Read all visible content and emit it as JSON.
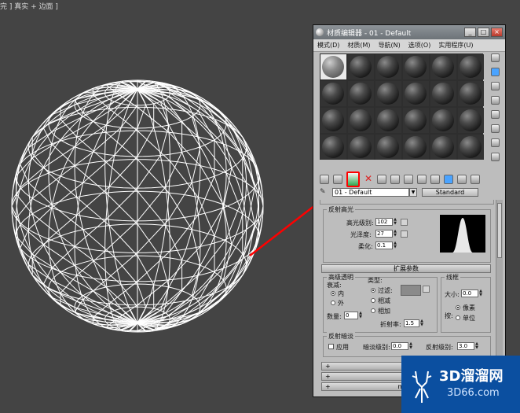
{
  "viewport": {
    "label": "完 ] 真实 + 边面 ]"
  },
  "material_editor": {
    "title": "材质编辑器 - 01 - Default",
    "window_buttons": [
      "_",
      "□",
      "×"
    ],
    "menus": [
      "模式(D)",
      "材质(M)",
      "导航(N)",
      "选项(O)",
      "实用程序(U)"
    ],
    "slot_count": 24,
    "material_name": "01 - Default",
    "material_type": "Standard",
    "specular_highlights": {
      "title": "反射高光",
      "specular_level_label": "高光级别:",
      "specular_level": "102",
      "glossiness_label": "光泽度:",
      "glossiness": "27",
      "soften_label": "柔化:",
      "soften": "0.1"
    },
    "extended_params": {
      "header": "扩展参数",
      "advanced_transparency_label": "高级透明",
      "falloff_label": "衰减:",
      "falloff_in": "内",
      "falloff_out": "外",
      "amount_label": "数量:",
      "amount": "0",
      "type_label": "类型:",
      "type_filter": "过滤:",
      "type_subtractive": "相减",
      "type_additive": "相加",
      "ior_label": "折射率:",
      "ior": "1.5",
      "wire_label": "线框",
      "size_label": "大小:",
      "size": "0.0",
      "in_label": "按:",
      "in_pixels": "像素",
      "in_units": "单位",
      "reflection_dimming_label": "反射暗淡",
      "apply_label": "应用",
      "dim_level_label": "暗淡级别:",
      "dim_level": "0.0",
      "refl_level_label": "反射级别:",
      "refl_level": "3.0"
    },
    "collapsed_rollouts": [
      "超",
      "",
      "ment"
    ]
  },
  "watermark": {
    "main": "3D溜溜网",
    "sub": "3D66.com"
  },
  "colors": {
    "viewport_bg": "#444444",
    "wireframe": "#ffffff",
    "highlight": "#ff0000",
    "watermark_bg": "#0b4fa0"
  }
}
